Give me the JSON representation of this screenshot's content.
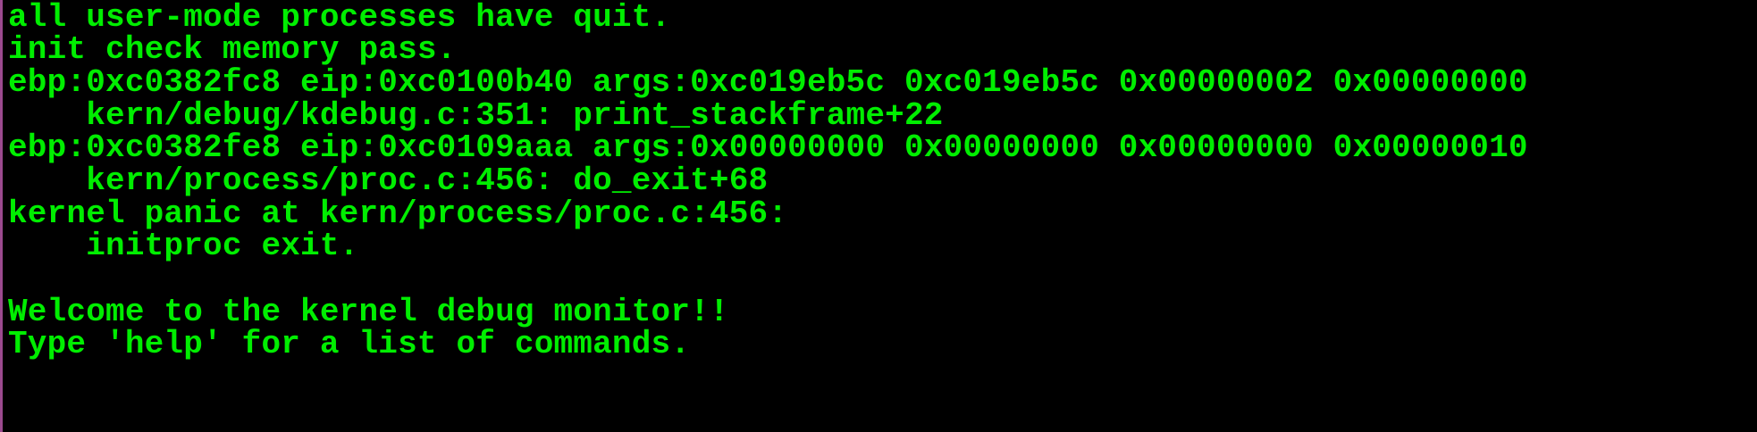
{
  "terminal": {
    "text_color": "#00ee00",
    "background_color": "#000000",
    "border_color": "#9b4a8e",
    "lines": [
      "all user-mode processes have quit.",
      "init check memory pass.",
      "ebp:0xc0382fc8 eip:0xc0100b40 args:0xc019eb5c 0xc019eb5c 0x00000002 0x00000000",
      "    kern/debug/kdebug.c:351: print_stackframe+22",
      "ebp:0xc0382fe8 eip:0xc0109aaa args:0x00000000 0x00000000 0x00000000 0x00000010",
      "    kern/process/proc.c:456: do_exit+68",
      "kernel panic at kern/process/proc.c:456:",
      "    initproc exit.",
      "",
      "Welcome to the kernel debug monitor!!",
      "Type 'help' for a list of commands."
    ]
  }
}
